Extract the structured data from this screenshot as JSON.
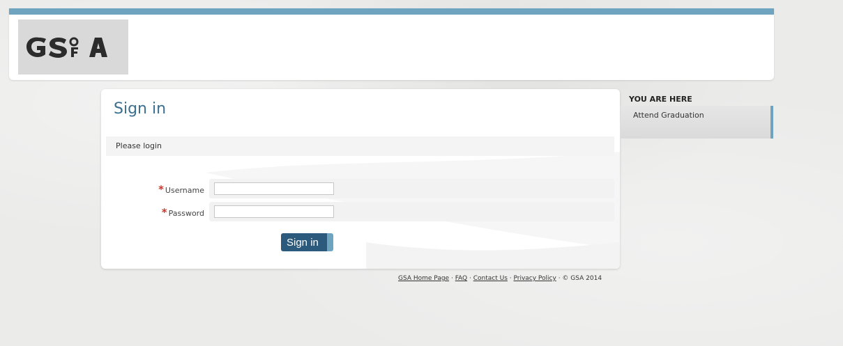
{
  "header": {
    "logo_text": "GSºA",
    "colors": {
      "accent_bar": "#6fa4c0",
      "logo_bg": "#d9d9d9"
    }
  },
  "main": {
    "title": "Sign in",
    "notice": "Please login",
    "username_label": "Username",
    "password_label": "Password",
    "required_marker": "*",
    "username_value": "",
    "password_value": "",
    "submit_label": "Sign in",
    "colors": {
      "title": "#3a6f8f",
      "button": "#2b5a7c",
      "required": "#c9372c"
    }
  },
  "sidebar": {
    "title": "YOU ARE HERE",
    "items": [
      {
        "label": "Attend Graduation"
      }
    ]
  },
  "footer": {
    "links": [
      {
        "label": "GSA Home Page"
      },
      {
        "label": "FAQ"
      },
      {
        "label": "Contact Us"
      },
      {
        "label": "Privacy Policy"
      }
    ],
    "separator": " · ",
    "copyright": "© GSA 2014"
  }
}
